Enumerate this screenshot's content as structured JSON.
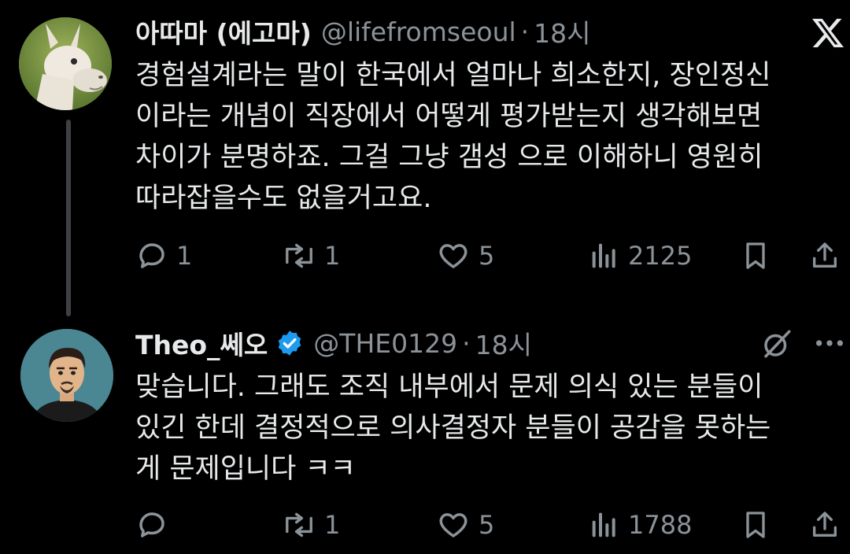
{
  "tweets": [
    {
      "author_name": "아따마 (에고마)",
      "handle": "@lifefromseoul",
      "separator": "·",
      "time": "18시",
      "text": "경험설계라는 말이 한국에서 얼마나 희소한지, 장인정신\n이라는 개념이 직장에서 어떻게 평가받는지 생각해보면\n차이가 분명하죠. 그걸 그냥 갬성 으로 이해하니 영원히\n따라잡을수도 없을거고요.",
      "reply_count": "1",
      "retweet_count": "1",
      "like_count": "5",
      "view_count": "2125",
      "avatar_icon": "llama-avatar",
      "corner_icon": "x-logo-icon"
    },
    {
      "author_name": "Theo_쎄오",
      "handle": "@THE0129",
      "separator": "·",
      "time": "18시",
      "text": "맞습니다. 그래도 조직 내부에서 문제 의식 있는 분들이\n있긴 한데 결정적으로 의사결정자 분들이 공감을 못하는\n게 문제입니다 ㅋㅋ",
      "reply_count": "",
      "retweet_count": "1",
      "like_count": "5",
      "view_count": "1788",
      "avatar_icon": "cartoon-man-avatar",
      "verified": true,
      "corner_icons": [
        "grok-icon",
        "more-icon"
      ]
    }
  ],
  "colors": {
    "background": "#000000",
    "text": "#e7e9ea",
    "muted": "#8b9298",
    "verified_blue": "#1d9bf0",
    "thread_line": "#3e4144"
  }
}
